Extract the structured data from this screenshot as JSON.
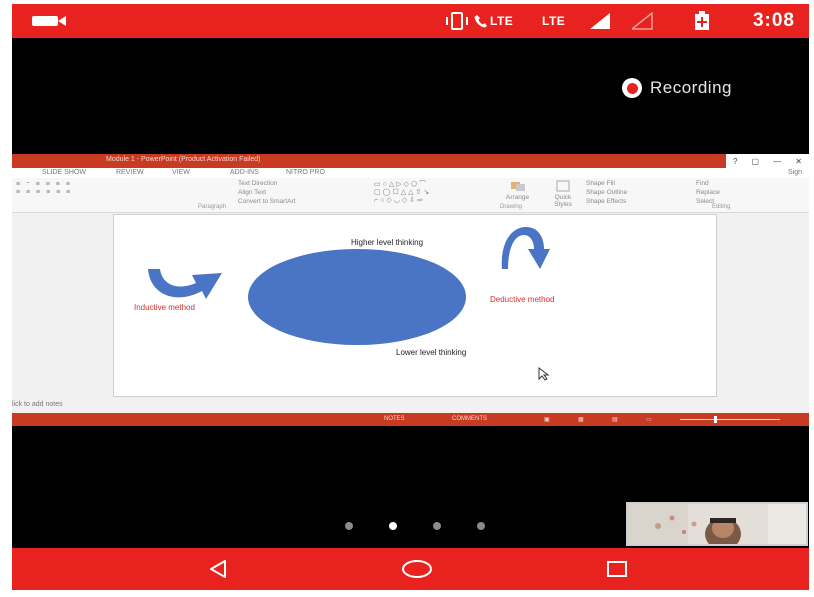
{
  "status_bar": {
    "signal_label_1": "LTE",
    "signal_label_2": "LTE",
    "time": "3:08",
    "icons": [
      "video-camera-icon",
      "vibrate-icon",
      "volte-call-icon",
      "signal-icon",
      "no-signal-icon",
      "battery-saver-icon"
    ]
  },
  "recording": {
    "label": "Recording"
  },
  "powerpoint": {
    "window_title": "Module 1 - PowerPoint (Product Activation Failed)",
    "window_controls": [
      "?",
      "▢",
      "—",
      "✕"
    ],
    "sign_in": "Sign",
    "tabs": [
      "SLIDE SHOW",
      "REVIEW",
      "VIEW",
      "ADD-INS",
      "NITRO PRO"
    ],
    "ribbon": {
      "paragraph_items": [
        "Text Direction",
        "Align Text",
        "Convert to SmartArt"
      ],
      "paragraph_label": "Paragraph",
      "arrange": "Arrange",
      "quick_styles": "Quick Styles",
      "shape_items": [
        "Shape Fill",
        "Shape Outline",
        "Shape Effects"
      ],
      "drawing_label": "Drawing",
      "editing_items": [
        "Find",
        "Replace",
        "Select"
      ],
      "editing_label": "Editing"
    },
    "slide": {
      "top_text": "Higher level thinking",
      "bottom_text": "Lower level thinking",
      "left_text": "Inductive method",
      "right_text": "Deductive method",
      "colors": {
        "circle": "#4a74c4",
        "method_text": "#d5312c"
      }
    },
    "notes_placeholder": "lick to add notes",
    "statusbar": {
      "notes": "NOTES",
      "comments": "COMMENTS"
    }
  },
  "pager": {
    "count": 4,
    "active_index": 1
  },
  "nav": {
    "buttons": [
      "back",
      "home",
      "recents"
    ]
  },
  "colors": {
    "accent": "#e8231f",
    "powerpoint": "#c83a22"
  }
}
